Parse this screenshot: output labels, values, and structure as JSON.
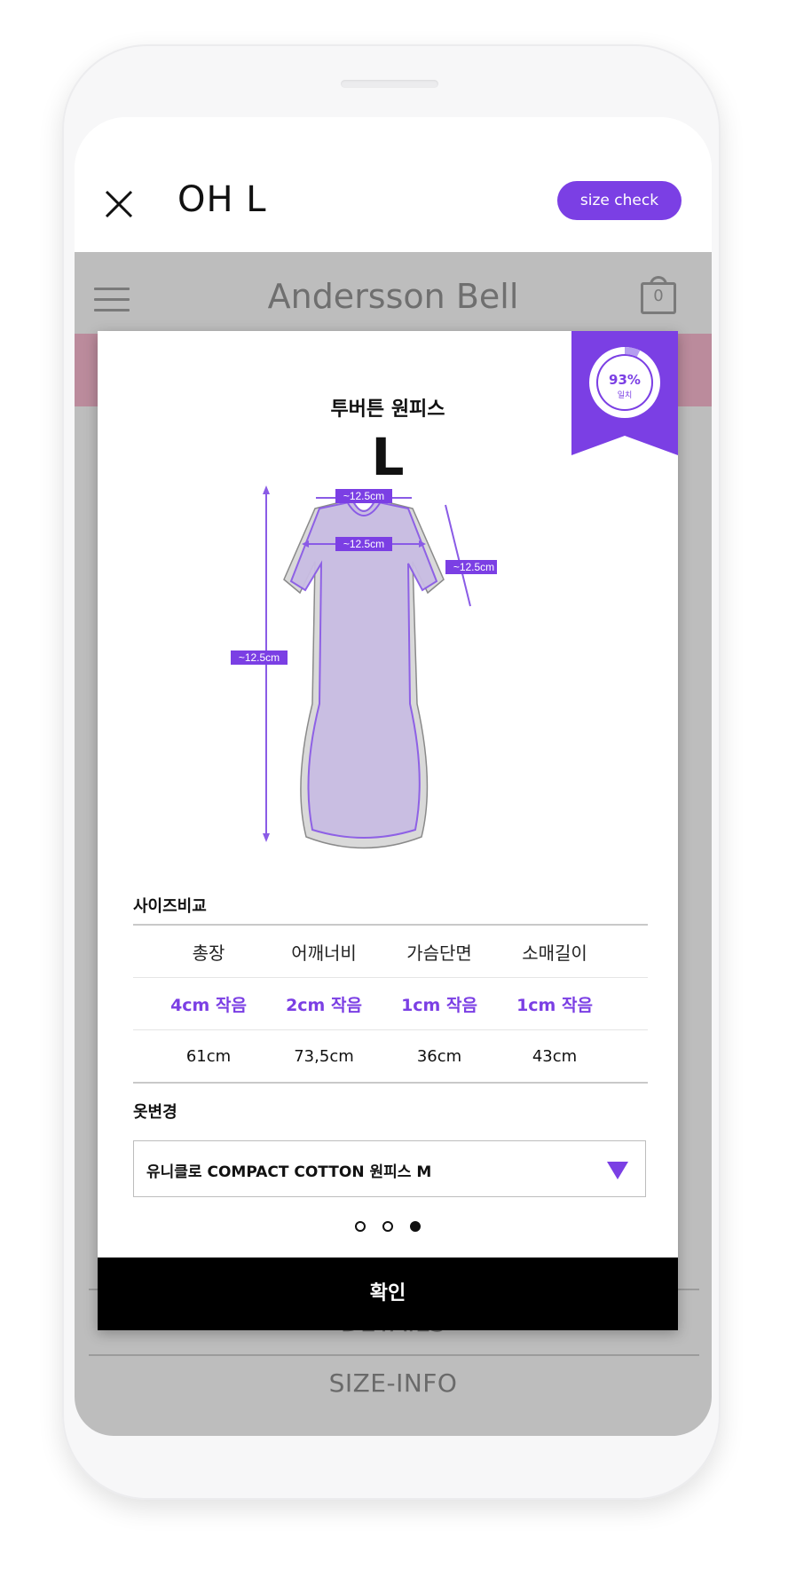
{
  "header": {
    "title": "OH L",
    "size_check_label": "size check"
  },
  "underlay": {
    "brand": "Andersson Bell",
    "cart_count": "0",
    "details_tab": "DETAILS",
    "size_info_tab": "SIZE-INFO"
  },
  "modal": {
    "match_percent": "93%",
    "match_label": "일치",
    "product_name": "투버튼 원피스",
    "size": "L",
    "measure_labels": {
      "shoulder": "~12.5cm",
      "chest": "~12.5cm",
      "sleeve": "~12.5cm",
      "length": "~12.5cm"
    },
    "compare_title": "사이즈비교",
    "columns": [
      "총장",
      "어깨너비",
      "가슴단면",
      "소매길이"
    ],
    "differences": [
      "4cm 작음",
      "2cm 작음",
      "1cm 작음",
      "1cm 작음"
    ],
    "values": [
      "61cm",
      "73,5cm",
      "36cm",
      "43cm"
    ],
    "closet_title": "옷변경",
    "closet_selected": "유니클로 COMPACT COTTON 원피스 M",
    "pages": 3,
    "active_page": 3,
    "confirm_label": "확인"
  },
  "colors": {
    "accent": "#7b3fe4",
    "dress_fill": "#c9bde3"
  }
}
